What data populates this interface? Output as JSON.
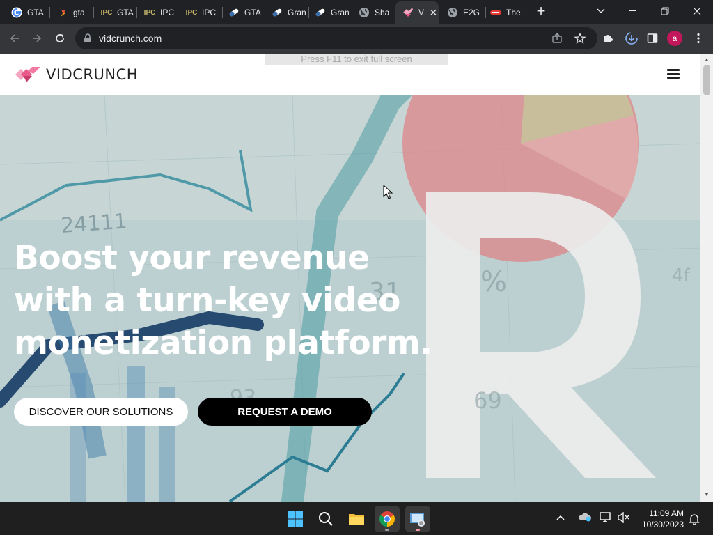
{
  "browser": {
    "tabs": [
      {
        "title": "GTA",
        "icon": "google-icon"
      },
      {
        "title": "gta",
        "icon": "gta-icon"
      },
      {
        "title": "GTA",
        "icon": "ipc-games-icon"
      },
      {
        "title": "IPC",
        "icon": "ipc-games-icon"
      },
      {
        "title": "IPC",
        "icon": "ipc-games-icon"
      },
      {
        "title": "GTA",
        "icon": "pill-icon"
      },
      {
        "title": "Gran",
        "icon": "pill-icon"
      },
      {
        "title": "Gran",
        "icon": "pill-icon"
      },
      {
        "title": "Sha",
        "icon": "globe-icon"
      },
      {
        "title": "V",
        "icon": "vidcrunch-icon",
        "active": true
      },
      {
        "title": "E2G",
        "icon": "globe-icon"
      },
      {
        "title": "The",
        "icon": "red-logo-icon"
      }
    ],
    "ipc_label": "IPC",
    "url": "vidcrunch.com",
    "profile_initial": "a",
    "fullscreen_hint": "Press F11 to exit full screen"
  },
  "site": {
    "brand": "VIDCRUNCH",
    "hero": {
      "line1": "Boost your revenue",
      "line2": "with a turn-key video",
      "line3": "monetization platform.",
      "primary_button": "DISCOVER OUR SOLUTIONS",
      "secondary_button": "REQUEST A DEMO"
    },
    "background_texts": {
      "n1": "24111",
      "pct": "%",
      "n2": "31",
      "n3": "69",
      "n4": "93",
      "n5": "4f",
      "big_letter": "R"
    }
  },
  "taskbar": {
    "time": "11:09 AM",
    "date": "10/30/2023"
  },
  "colors": {
    "brand_pink": "#e85a8a",
    "chrome_bg": "#202124",
    "toolbar_bg": "#35363a",
    "taskbar_bg": "#1f1f1f"
  }
}
